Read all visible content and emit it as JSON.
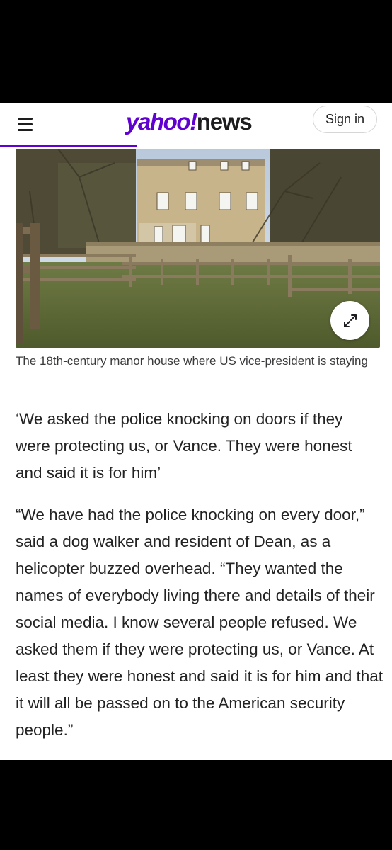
{
  "header": {
    "logo_yahoo": "yahoo",
    "logo_bang": "!",
    "logo_news": "news",
    "signin_label": "Sign in",
    "accent_color": "#6001d2"
  },
  "reading_progress": 0.35,
  "article": {
    "image_caption": "The 18th-century manor house where US vice-president is staying",
    "pull_quote": "‘We asked the police knocking on doors if they were protecting us, or Vance. They were honest and said it is for him’",
    "paragraph": "“We have had the police knocking on every door,” said a dog walker and resident of Dean, as a helicopter buzzed overhead. “They wanted the names of everybody living there and details of their social media. I know several people refused. We asked them if they were protecting us, or Vance. At least they were honest and said it is for him and that it will all be passed on to the American security people.”"
  },
  "icons": {
    "menu": "hamburger-menu-icon",
    "expand": "expand-arrows-icon"
  }
}
